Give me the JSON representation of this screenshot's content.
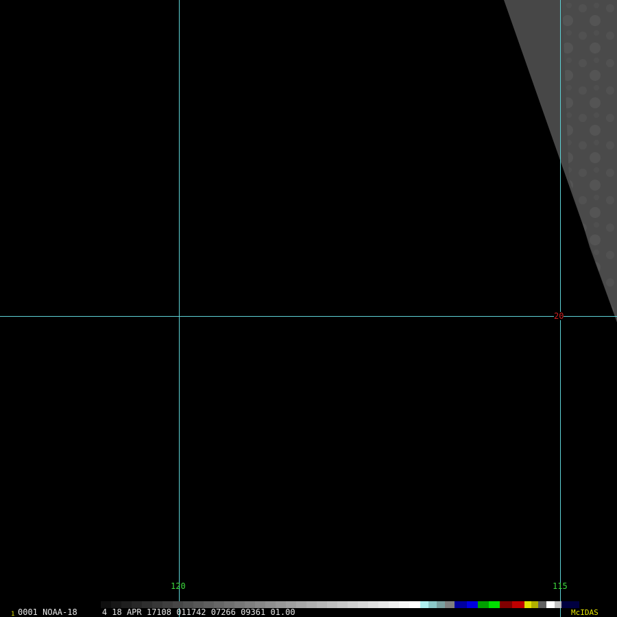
{
  "image": {
    "satellite_swath": "visible",
    "grid_color": "#5fd4d8"
  },
  "gridlines": {
    "longitudes": [
      "120",
      "115"
    ],
    "latitudes": [
      "20"
    ]
  },
  "labels": {
    "lon_120": "120",
    "lon_115": "115",
    "lat_20": "20"
  },
  "info_bar": {
    "frame_number": "1",
    "text": "0001 NOAA-18     4 18 APR 17108 011742 07266 09361 01.00",
    "brand": "McIDAS"
  },
  "colors": {
    "label_lon": "#3ddc3d",
    "label_lat": "#d02020",
    "brand": "#e6e600"
  }
}
